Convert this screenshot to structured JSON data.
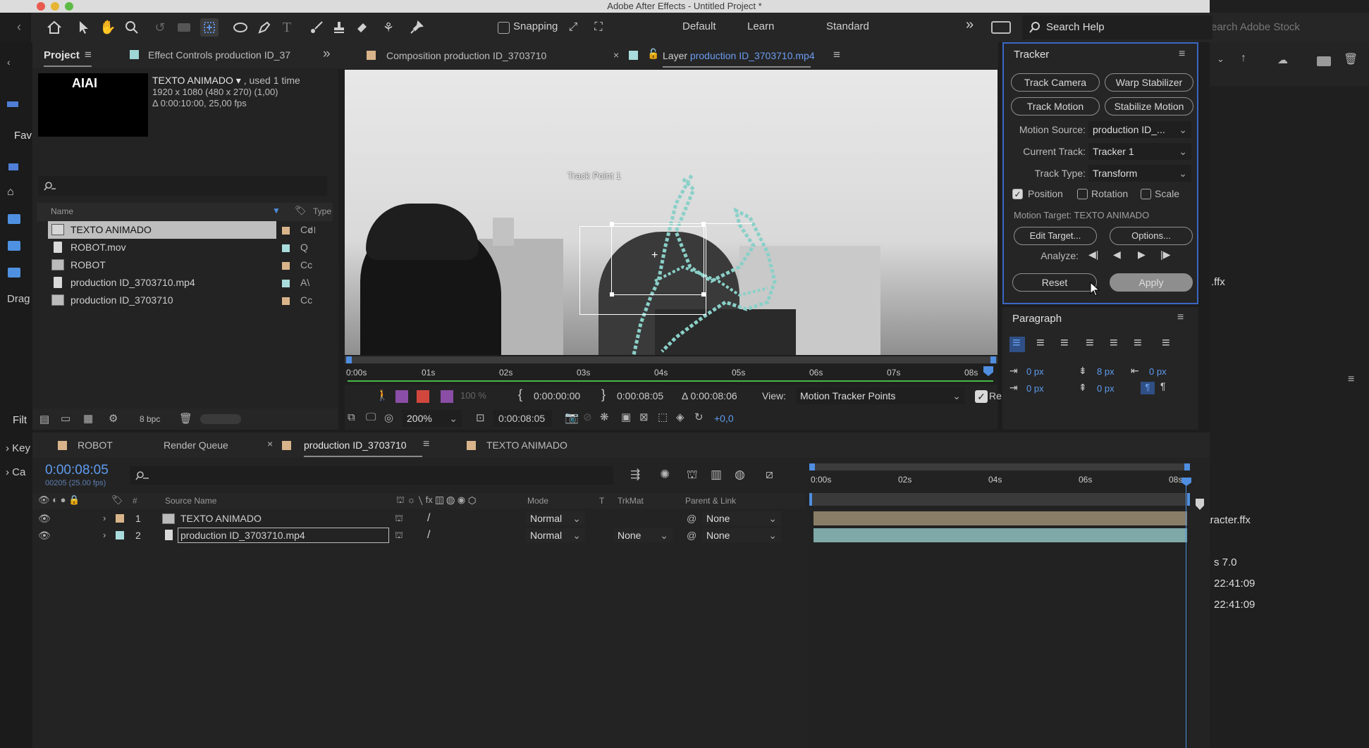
{
  "window_title": "Adobe After Effects - Untitled Project *",
  "toolbar": {
    "snapping_label": "Snapping",
    "workspaces": [
      "Default",
      "Learn",
      "Standard"
    ],
    "search_help": "Search Help",
    "search_stock": "earch Adobe Stock"
  },
  "left_strip": {
    "fav": "Fav",
    "drag": "Drag",
    "filt": "Filt",
    "key": "Key",
    "ca": "Ca"
  },
  "project": {
    "tab_project": "Project",
    "tab_effects": "Effect Controls production ID_37",
    "thumb_text": "AIAI",
    "item_name": "TEXTO ANIMADO",
    "item_used": ", used 1 time",
    "item_size": "1920 x 1080  (480 x 270) (1,00)",
    "item_dur": "Δ 0:00:10:00, 25,00 fps",
    "col_name": "Name",
    "col_type": "Type",
    "items": [
      {
        "name": "TEXTO ANIMADO",
        "type": "Co"
      },
      {
        "name": "ROBOT.mov",
        "type": "Q"
      },
      {
        "name": "ROBOT",
        "type": "Cc"
      },
      {
        "name": "production ID_3703710.mp4",
        "type": "A\\"
      },
      {
        "name": "production ID_3703710",
        "type": "Cc"
      }
    ],
    "bpc": "8 bpc"
  },
  "viewer": {
    "tab_comp": "Composition production ID_3703710",
    "tab_layer_prefix": "Layer",
    "tab_layer_name": "production ID_3703710.mp4",
    "track_point_label": "Track Point 1",
    "ruler_ticks": [
      "0:00s",
      "01s",
      "02s",
      "03s",
      "04s",
      "05s",
      "06s",
      "07s",
      "08s"
    ],
    "in_time": "0:00:00:00",
    "out_time": "0:00:08:05",
    "duration": "Δ 0:00:08:06",
    "view_label": "View:",
    "view_value": "Motion Tracker Points",
    "render_label": "Re",
    "zoom_pct": "100 %",
    "zoom": "200%",
    "current_time": "0:00:08:05",
    "exposure": "+0,0"
  },
  "tracker": {
    "title": "Tracker",
    "btn_track_camera": "Track Camera",
    "btn_warp": "Warp Stabilizer",
    "btn_track_motion": "Track Motion",
    "btn_stabilize": "Stabilize Motion",
    "motion_source_label": "Motion Source:",
    "motion_source_value": "production ID_...",
    "current_track_label": "Current Track:",
    "current_track_value": "Tracker 1",
    "track_type_label": "Track Type:",
    "track_type_value": "Transform",
    "position_label": "Position",
    "rotation_label": "Rotation",
    "scale_label": "Scale",
    "motion_target": "Motion Target: TEXTO ANIMADO",
    "btn_edit_target": "Edit Target...",
    "btn_options": "Options...",
    "analyze_label": "Analyze:",
    "btn_reset": "Reset",
    "btn_apply": "Apply"
  },
  "paragraph": {
    "title": "Paragraph",
    "indent_left": "0 px",
    "space_before": "8 px",
    "indent_right": "0 px",
    "first_line": "0 px",
    "space_after": "0 px"
  },
  "right_side": {
    "ffx1": ".ffx",
    "ffx2": "haracter.ffx",
    "ver": "s 7.0",
    "time1": "22:41:09",
    "time2": "22:41:09"
  },
  "timeline": {
    "tabs": [
      "ROBOT",
      "Render Queue",
      "production ID_3703710",
      "TEXTO ANIMADO"
    ],
    "timecode": "0:00:08:05",
    "frames": "00205 (25.00 fps)",
    "col_source": "Source Name",
    "col_mode": "Mode",
    "col_t": "T",
    "col_trkmat": "TrkMat",
    "col_parent": "Parent & Link",
    "ruler": [
      "0:00s",
      "02s",
      "04s",
      "06s",
      "08s"
    ],
    "layers": [
      {
        "num": "1",
        "name": "TEXTO ANIMADO",
        "mode": "Normal",
        "trkmat": "",
        "parent": "None"
      },
      {
        "num": "2",
        "name": "production ID_3703710.mp4",
        "mode": "Normal",
        "trkmat": "None",
        "parent": "None"
      }
    ]
  }
}
